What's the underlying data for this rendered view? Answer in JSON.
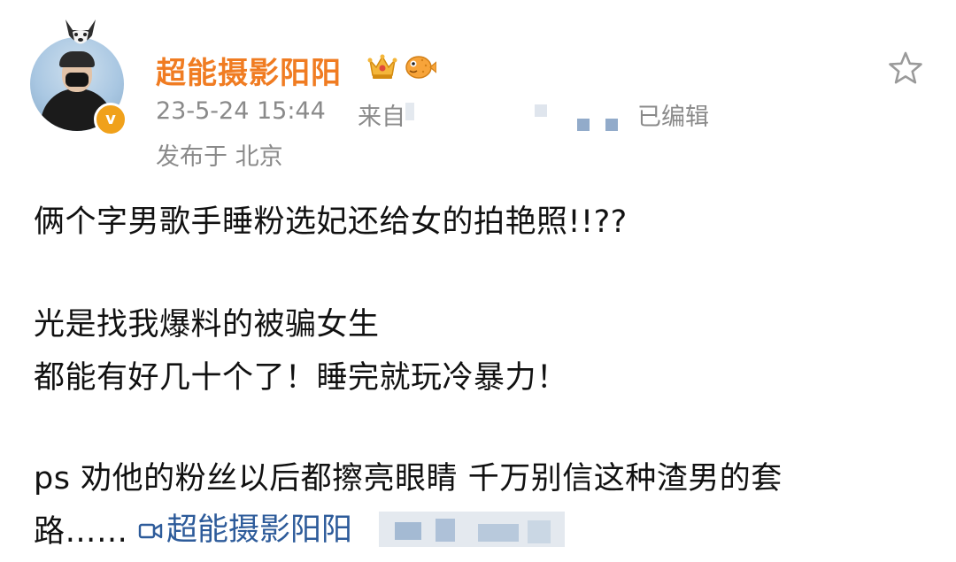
{
  "post": {
    "author": {
      "name": "超能摄影阳阳",
      "avatar_icon": "user-avatar",
      "badge_icon": "verified-v-badge",
      "badge_text": "v",
      "colors": {
        "name": "#f07c22",
        "badge": "#f0a11b"
      }
    },
    "meta": {
      "timestamp": "23-5-24 15:44",
      "source_prefix": "来自",
      "edited": "已编辑",
      "location": "发布于 北京"
    },
    "actions": {
      "favorite_icon": "star-outline-icon"
    },
    "content": {
      "line1": "俩个字男歌手睡粉选妃还给女的拍艳照!!??",
      "line2": "光是找我爆料的被骗女生",
      "line3": "都能有好几十个了！睡完就玩冷暴力！",
      "line4": "ps 劝他的粉丝以后都擦亮眼睛   千万别信这种渣男的套",
      "line5_prefix": "路……",
      "mention": "超能摄影阳阳",
      "mention_color": "#2d5b9a",
      "mention_icon": "video-camera-icon"
    }
  }
}
